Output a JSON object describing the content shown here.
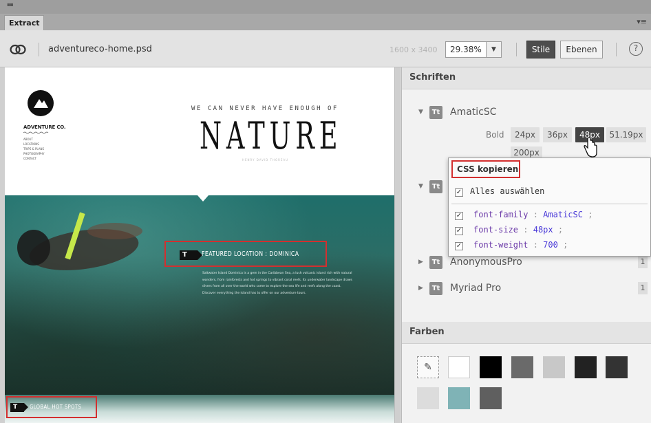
{
  "panel": {
    "tab_title": "Extract"
  },
  "toolbar": {
    "filename": "adventureco-home.psd",
    "dimensions": "1600 x 3400",
    "zoom_value": "29.38%",
    "btn_stile": "Stile",
    "btn_ebenen": "Ebenen",
    "help": "?"
  },
  "doc": {
    "logo_name": "ADVENTURE CO.",
    "nav_items": [
      "ABOUT",
      "LOCATIONS",
      "TRIPS & PLANS",
      "PHOTOGRAPHY",
      "CONTACT"
    ],
    "tagline": "WE CAN NEVER HAVE ENOUGH OF",
    "headline": "NATURE",
    "sub_tagline": "HENRY DAVID THOREAU",
    "featured_badge": "T",
    "featured_text": "FEATURED LOCATION : DOMINICA",
    "body_copy": "Saltwater Island Dominica is a gem in the Caribbean Sea, a lush volcanic island rich with natural wonders, from rainforests and hot springs to vibrant coral reefs. Its underwater landscape draws divers from all over the world who come to explore the sea life and reefs along the coast. Discover everything the island has to offer on our adventure tours.",
    "bottom_badge": "T",
    "bottom_text": "GLOBAL HOT SPOTS"
  },
  "fonts_section": {
    "title": "Schriften",
    "fonts": [
      {
        "name": "AmaticSC",
        "expanded": true
      },
      {
        "name": "",
        "expanded": true
      },
      {
        "name": "AnonymousPro",
        "count": "1"
      },
      {
        "name": "Myriad Pro",
        "count": "1"
      }
    ],
    "weight_label": "Bold",
    "sizes": [
      "24px",
      "36px",
      "48px",
      "51.19px",
      "200px"
    ],
    "active_size": "48px"
  },
  "css_popup": {
    "title": "CSS kopieren",
    "select_all": "Alles auswählen",
    "properties": [
      {
        "key": "font-family",
        "value": "AmaticSC"
      },
      {
        "key": "font-size",
        "value": "48px"
      },
      {
        "key": "font-weight",
        "value": "700"
      }
    ]
  },
  "colors_section": {
    "title": "Farben",
    "swatches": [
      "#ffffff",
      "#000000",
      "#6a6a6a",
      "#c8c8c8",
      "#222222",
      "#333333",
      "#dcdcdc",
      "#7fb3b6",
      "#5f5f5f"
    ]
  }
}
